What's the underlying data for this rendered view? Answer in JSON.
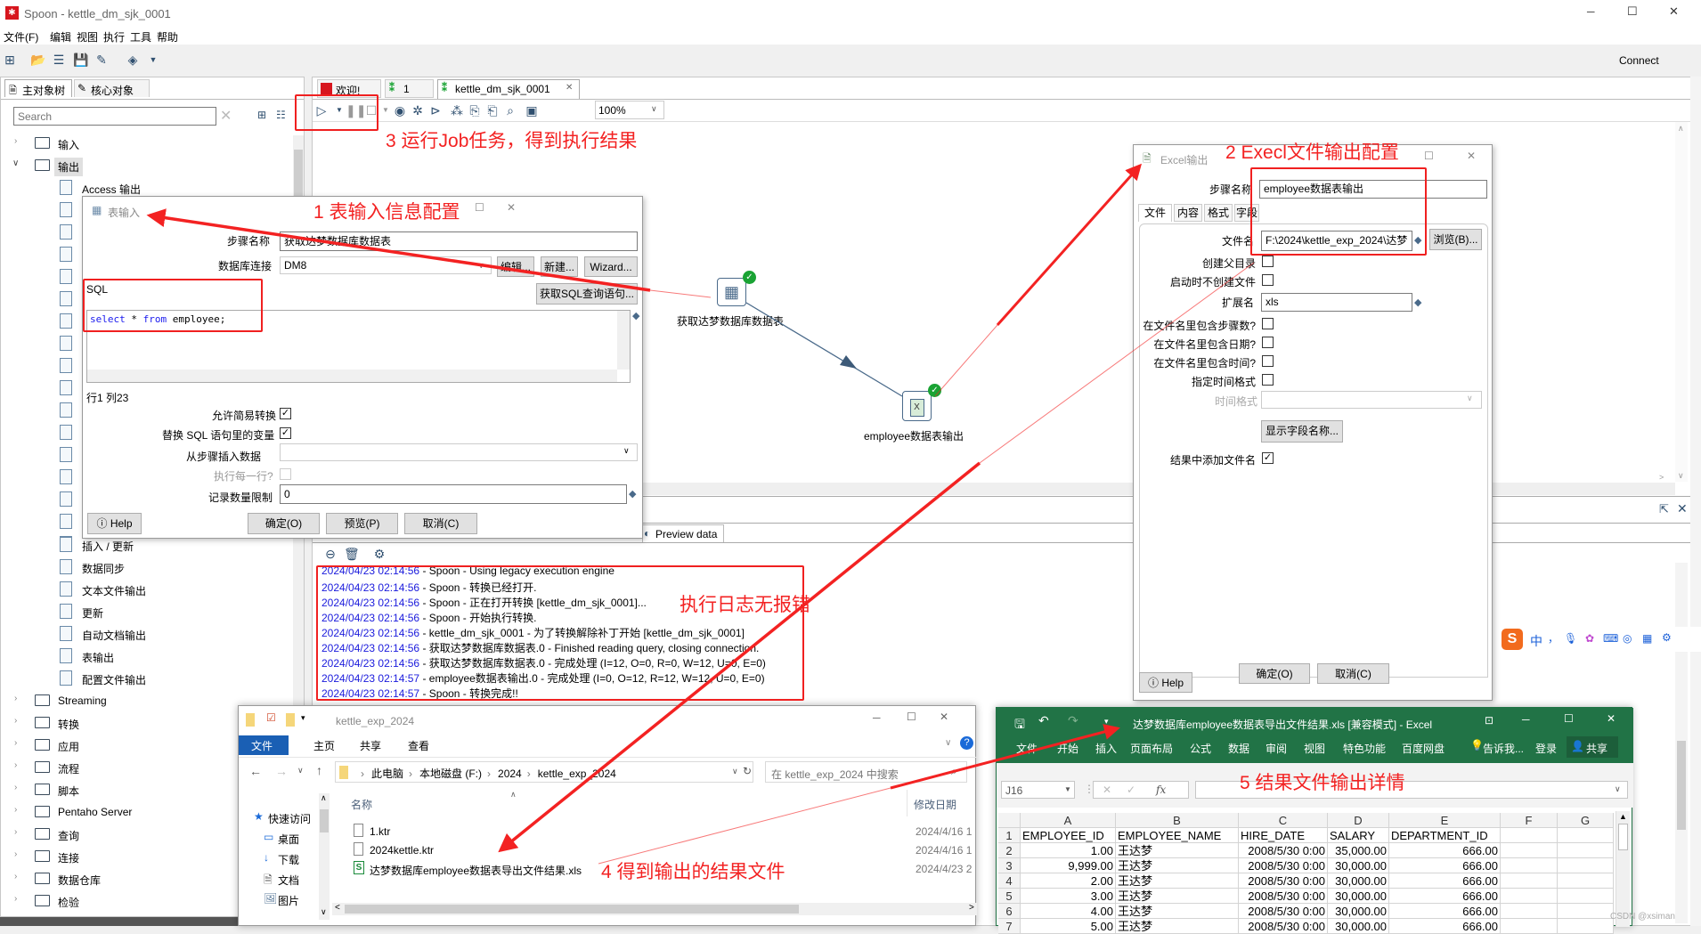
{
  "window": {
    "title": "Spoon - kettle_dm_sjk_0001",
    "min": "─",
    "max": "☐",
    "close": "✕"
  },
  "menu": [
    "文件(F)",
    "编辑",
    "视图",
    "执行",
    "工具",
    "帮助"
  ],
  "toolbar": {
    "connect": "Connect"
  },
  "left_tabs": [
    "主对象树",
    "核心对象"
  ],
  "search": {
    "placeholder": "Search"
  },
  "tree": {
    "top": [
      {
        "label": "输入",
        "expanded": false
      },
      {
        "label": "输出",
        "expanded": true
      }
    ],
    "first_child": "Access 输出",
    "visible_children": [
      "插入 / 更新",
      "数据同步",
      "文本文件输出",
      "更新",
      "自动文档输出",
      "表输出",
      "配置文件输出"
    ],
    "folders": [
      "Streaming",
      "转换",
      "应用",
      "流程",
      "脚本",
      "Pentaho Server",
      "查询",
      "连接",
      "数据仓库",
      "检验"
    ]
  },
  "editor_tabs": [
    "欢迎!",
    "1",
    "kettle_dm_sjk_0001"
  ],
  "zoom": "100%",
  "canvas": {
    "steps": [
      {
        "label": "获取达梦数据库数据表",
        "status": "success"
      },
      {
        "label": "employee数据表输出",
        "status": "success"
      }
    ]
  },
  "bottom": {
    "preview_tab": "Preview data"
  },
  "log": [
    {
      "time": "2024/04/23 02:14:56",
      "text": " - Spoon - Using legacy execution engine"
    },
    {
      "time": "2024/04/23 02:14:56",
      "text": " - Spoon - 转换已经打开."
    },
    {
      "time": "2024/04/23 02:14:56",
      "text": " - Spoon - 正在打开转换 [kettle_dm_sjk_0001]..."
    },
    {
      "time": "2024/04/23 02:14:56",
      "text": " - Spoon - 开始执行转换."
    },
    {
      "time": "2024/04/23 02:14:56",
      "text": " - kettle_dm_sjk_0001 - 为了转换解除补丁开始  [kettle_dm_sjk_0001]"
    },
    {
      "time": "2024/04/23 02:14:56",
      "text": " - 获取达梦数据库数据表.0 - Finished reading query, closing connection."
    },
    {
      "time": "2024/04/23 02:14:56",
      "text": " - 获取达梦数据库数据表.0 - 完成处理 (I=12, O=0, R=0, W=12, U=0, E=0)"
    },
    {
      "time": "2024/04/23 02:14:57",
      "text": " - employee数据表输出.0 - 完成处理 (I=0, O=12, R=12, W=12, U=0, E=0)"
    },
    {
      "time": "2024/04/23 02:14:57",
      "text": " - Spoon - 转换完成!!"
    }
  ],
  "table_input": {
    "title": "表输入",
    "step_name_label": "步骤名称",
    "step_name": "获取达梦数据库数据表",
    "db_label": "数据库连接",
    "db": "DM8",
    "edit": "编辑...",
    "new": "新建...",
    "wizard": "Wizard...",
    "sql_label": "SQL",
    "get_sql": "获取SQL查询语句...",
    "sql": {
      "kw1": "select",
      "mid": " * ",
      "kw2": "from",
      "rest": " employee;"
    },
    "cursor": "行1 列23",
    "lazy_label": "允许简易转换",
    "lazy": true,
    "replace_label": "替换 SQL 语句里的变量",
    "replace": true,
    "insert_label": "从步骤插入数据",
    "insert": "",
    "each_row_label": "执行每一行?",
    "each_row": false,
    "limit_label": "记录数量限制",
    "limit": "0",
    "help": "Help",
    "ok": "确定(O)",
    "preview": "预览(P)",
    "cancel": "取消(C)"
  },
  "excel_output": {
    "title": "Excel输出",
    "step_name_label": "步骤名称",
    "step_name": "employee数据表输出",
    "tabs": [
      "文件",
      "内容",
      "格式",
      "字段"
    ],
    "filename_label": "文件名",
    "filename": "F:\\2024\\kettle_exp_2024\\达梦",
    "browse": "浏览(B)...",
    "create_parent_label": "创建父目录",
    "create_parent": false,
    "no_create_label": "启动时不创建文件",
    "no_create": false,
    "ext_label": "扩展名",
    "ext": "xls",
    "stepnr_label": "在文件名里包含步骤数?",
    "stepnr": false,
    "date_label": "在文件名里包含日期?",
    "date": false,
    "time_label": "在文件名里包含时间?",
    "time": false,
    "spec_fmt_label": "指定时间格式",
    "spec_fmt": false,
    "fmt_label": "时间格式",
    "fmt": "",
    "show_fields": "显示字段名称...",
    "add_result_label": "结果中添加文件名",
    "add_result": true,
    "help": "Help",
    "ok": "确定(O)",
    "cancel": "取消(C)"
  },
  "explorer": {
    "title": "kettle_exp_2024",
    "ribbon": [
      "文件",
      "主页",
      "共享",
      "查看"
    ],
    "path": [
      "此电脑",
      "本地磁盘 (F:)",
      "2024",
      "kettle_exp_2024"
    ],
    "search_placeholder": "在 kettle_exp_2024 中搜索",
    "nav": [
      "快速访问",
      "桌面",
      "下载",
      "文档",
      "图片"
    ],
    "col_name": "名称",
    "col_date": "修改日期",
    "files": [
      {
        "name": "1.ktr",
        "date": "2024/4/16 1",
        "type": "ktr"
      },
      {
        "name": "2024kettle.ktr",
        "date": "2024/4/16 1",
        "type": "ktr"
      },
      {
        "name": "达梦数据库employee数据表导出文件结果.xls",
        "date": "2024/4/23 2",
        "type": "xls"
      }
    ]
  },
  "excel": {
    "title": "达梦数据库employee数据表导出文件结果.xls  [兼容模式] - Excel",
    "tabs": [
      "文件",
      "开始",
      "插入",
      "页面布局",
      "公式",
      "数据",
      "审阅",
      "视图",
      "特色功能",
      "百度网盘"
    ],
    "tell": "告诉我...",
    "login": "登录",
    "share": "共享",
    "namebox": "J16",
    "fx": "fx",
    "columns": [
      "A",
      "B",
      "C",
      "D",
      "E",
      "F",
      "G"
    ],
    "rows": [
      [
        "EMPLOYEE_ID",
        "EMPLOYEE_NAME",
        "HIRE_DATE",
        "SALARY",
        "DEPARTMENT_ID",
        "",
        ""
      ],
      [
        "1.00",
        "王达梦",
        "2008/5/30 0:00",
        "35,000.00",
        "666.00",
        "",
        ""
      ],
      [
        "9,999.00",
        "王达梦",
        "2008/5/30 0:00",
        "30,000.00",
        "666.00",
        "",
        ""
      ],
      [
        "2.00",
        "王达梦",
        "2008/5/30 0:00",
        "30,000.00",
        "666.00",
        "",
        ""
      ],
      [
        "3.00",
        "王达梦",
        "2008/5/30 0:00",
        "30,000.00",
        "666.00",
        "",
        ""
      ],
      [
        "4.00",
        "王达梦",
        "2008/5/30 0:00",
        "30,000.00",
        "666.00",
        "",
        ""
      ],
      [
        "5.00",
        "王达梦",
        "2008/5/30 0:00",
        "30,000.00",
        "666.00",
        "",
        ""
      ]
    ]
  },
  "annotations": {
    "a1": "1 表输入信息配置",
    "a2": "2 Execl文件输出配置",
    "a3": "3 运行Job任务，得到执行结果",
    "a4": "4 得到输出的结果文件",
    "a5": "5 结果文件输出详情",
    "log_note": "执行日志无报错",
    "color": "#f32222"
  },
  "ime": {
    "mode": "中",
    "punct": "，"
  },
  "watermark": "CSDN @xsiman"
}
